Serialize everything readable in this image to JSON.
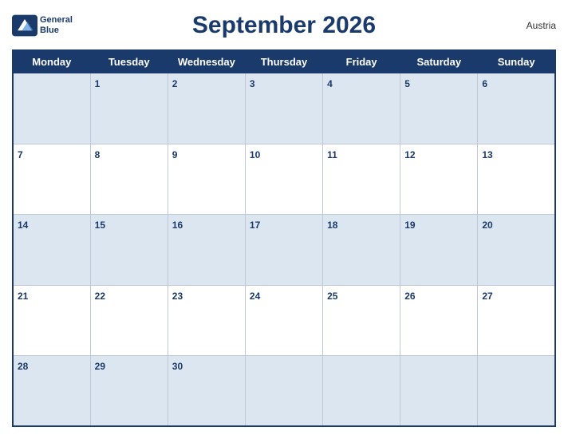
{
  "header": {
    "title": "September 2026",
    "country": "Austria",
    "logo_line1": "General",
    "logo_line2": "Blue"
  },
  "weekdays": [
    "Monday",
    "Tuesday",
    "Wednesday",
    "Thursday",
    "Friday",
    "Saturday",
    "Sunday"
  ],
  "weeks": [
    [
      "",
      "1",
      "2",
      "3",
      "4",
      "5",
      "6"
    ],
    [
      "7",
      "8",
      "9",
      "10",
      "11",
      "12",
      "13"
    ],
    [
      "14",
      "15",
      "16",
      "17",
      "18",
      "19",
      "20"
    ],
    [
      "21",
      "22",
      "23",
      "24",
      "25",
      "26",
      "27"
    ],
    [
      "28",
      "29",
      "30",
      "",
      "",
      "",
      ""
    ]
  ]
}
